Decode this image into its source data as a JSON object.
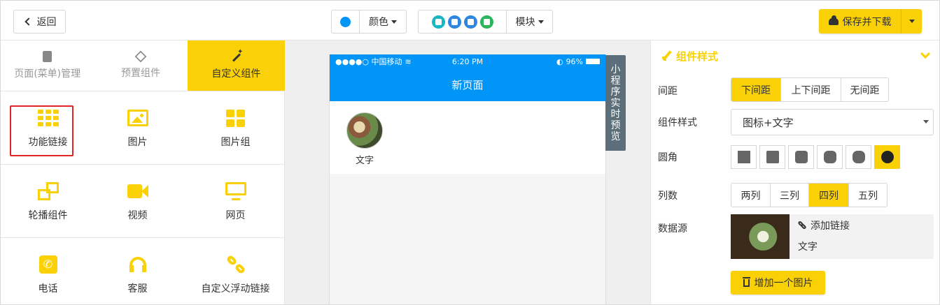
{
  "toolbar": {
    "back_label": "返回",
    "color_label": "颜色",
    "module_label": "模块",
    "save_label": "保存并下载",
    "accent_color": "#fad106",
    "theme_color": "#0095f6"
  },
  "left_tabs": [
    {
      "label": "页面(菜单)管理",
      "icon": "pages-icon",
      "active": false
    },
    {
      "label": "预置组件",
      "icon": "cube-icon",
      "active": false
    },
    {
      "label": "自定义组件",
      "icon": "magic-wand-icon",
      "active": true
    }
  ],
  "components": [
    {
      "label": "功能链接",
      "icon": "grid-icon",
      "selected": true
    },
    {
      "label": "图片",
      "icon": "image-icon"
    },
    {
      "label": "图片组",
      "icon": "image-group-icon"
    },
    {
      "label": "轮播组件",
      "icon": "carousel-icon"
    },
    {
      "label": "视频",
      "icon": "video-icon"
    },
    {
      "label": "网页",
      "icon": "monitor-icon"
    },
    {
      "label": "电话",
      "icon": "phone-icon"
    },
    {
      "label": "客服",
      "icon": "headset-icon"
    },
    {
      "label": "自定义浮动链接",
      "icon": "link-icon"
    }
  ],
  "preview": {
    "carrier": "●●●●○ 中国移动",
    "time": "6:20 PM",
    "battery": "96%",
    "page_title": "新页面",
    "item_text": "文字",
    "live_tab": [
      "小",
      "程",
      "序",
      "实",
      "时",
      "预",
      "览"
    ]
  },
  "style_panel": {
    "title": "组件样式",
    "spacing_label": "间距",
    "spacing_options": [
      "下间距",
      "上下间距",
      "无间距"
    ],
    "spacing_selected": 0,
    "style_label": "组件样式",
    "style_value": "图标+文字",
    "radius_label": "圆角",
    "radius_selected": 5,
    "columns_label": "列数",
    "columns_options": [
      "两列",
      "三列",
      "四列",
      "五列"
    ],
    "columns_selected": 2,
    "datasource_label": "数据源",
    "add_link_label": "添加链接",
    "ds_text": "文字",
    "add_image_label": "增加一个图片"
  }
}
